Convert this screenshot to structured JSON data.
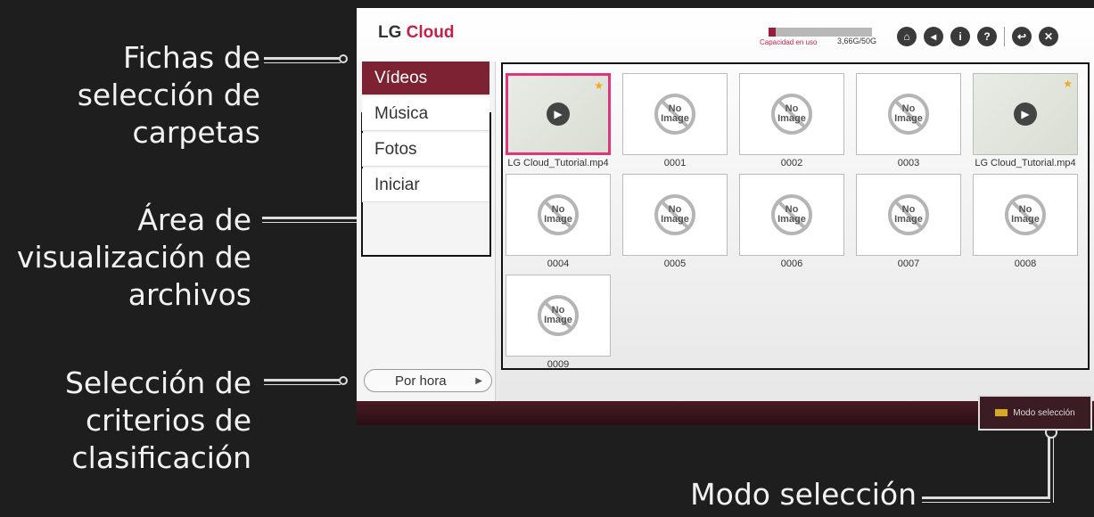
{
  "callouts": {
    "tabs": [
      "Fichas de",
      "selección de",
      "carpetas"
    ],
    "area": [
      "Área de",
      "visualización de",
      "archivos"
    ],
    "sort": [
      "Selección de",
      "criterios de",
      "clasificación"
    ],
    "mode": "Modo selección"
  },
  "app": {
    "logo_lg": "LG",
    "logo_cloud": "Cloud",
    "capacity_label": "Capacidad en uso",
    "capacity_value": "3,66G/50G",
    "capacity_fraction": 0.07,
    "icons": [
      "home-icon",
      "back-icon",
      "info-icon",
      "help-icon",
      "return-icon",
      "close-icon"
    ],
    "tabs": [
      "Vídeos",
      "Música",
      "Fotos",
      "Iniciar"
    ],
    "active_tab": 0,
    "sort_label": "Por hora",
    "files": [
      {
        "name": "LG Cloud_Tutorial.mp4",
        "type": "video",
        "starred": true,
        "selected": true
      },
      {
        "name": "0001",
        "type": "none"
      },
      {
        "name": "0002",
        "type": "none"
      },
      {
        "name": "0003",
        "type": "none"
      },
      {
        "name": "LG Cloud_Tutorial.mp4",
        "type": "video",
        "starred": true
      },
      {
        "name": "0004",
        "type": "none"
      },
      {
        "name": "0005",
        "type": "none"
      },
      {
        "name": "0006",
        "type": "none"
      },
      {
        "name": "0007",
        "type": "none"
      },
      {
        "name": "0008",
        "type": "none"
      },
      {
        "name": "0009",
        "type": "none"
      }
    ],
    "no_image_text": "No Image",
    "select_mode_label": "Modo selección",
    "accent_color": "#7c2232"
  }
}
